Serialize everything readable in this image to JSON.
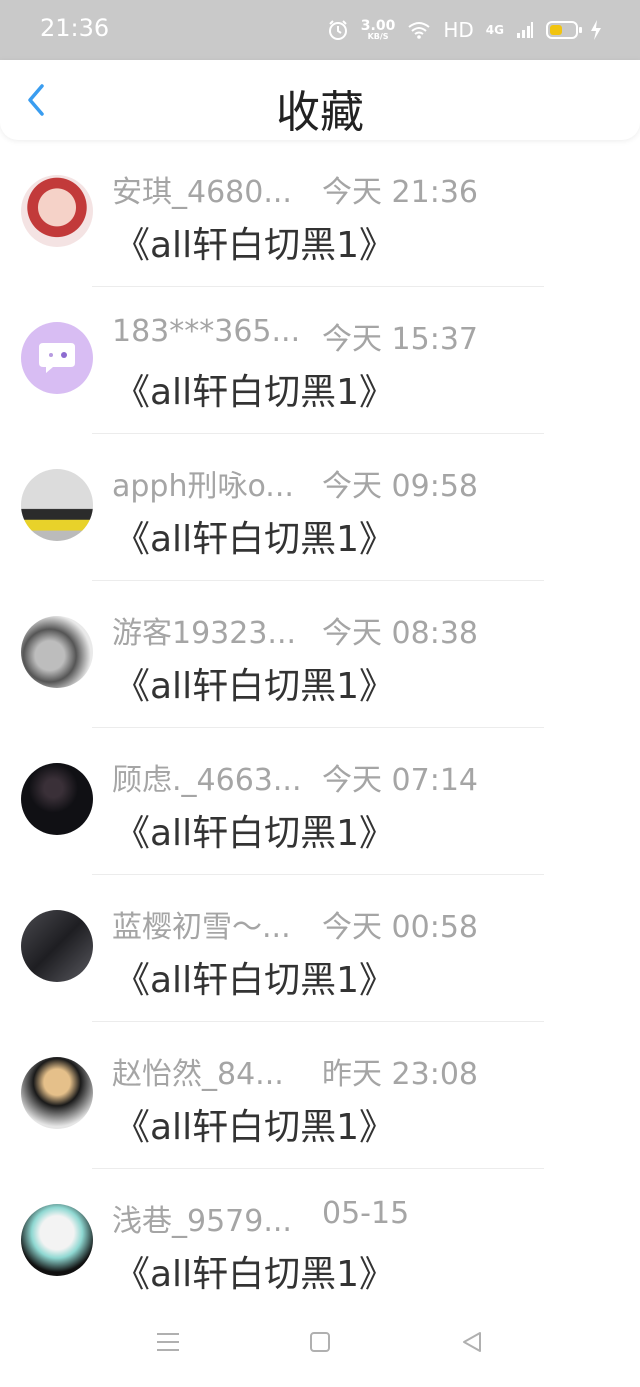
{
  "status_bar": {
    "time": "21:36",
    "speed_value": "3.00",
    "speed_unit": "KB/S",
    "hd": "HD",
    "network": "4G",
    "icons": [
      "alarm-icon",
      "wifi-icon",
      "signal-icon",
      "battery-icon",
      "charging-icon"
    ]
  },
  "header": {
    "title": "收藏",
    "back_icon": "chevron-left-icon"
  },
  "favorites": [
    {
      "name": "安琪_4680...",
      "time": "今天 21:36",
      "book": "《all轩白切黑1》"
    },
    {
      "name": "183***365...",
      "time": "今天 15:37",
      "book": "《all轩白切黑1》"
    },
    {
      "name": "apph刑咏o...",
      "time": "今天 09:58",
      "book": "《all轩白切黑1》"
    },
    {
      "name": "游客19323...",
      "time": "今天 08:38",
      "book": "《all轩白切黑1》"
    },
    {
      "name": "顾虑._4663...",
      "time": "今天 07:14",
      "book": "《all轩白切黑1》"
    },
    {
      "name": "蓝樱初雪～...",
      "time": "今天 00:58",
      "book": "《all轩白切黑1》"
    },
    {
      "name": "赵怡然_84...",
      "time": "昨天 23:08",
      "book": "《all轩白切黑1》"
    },
    {
      "name": "浅巷_9579...",
      "time": "05-15",
      "book": "《all轩白切黑1》"
    }
  ],
  "nav_bar": {
    "icons": [
      "menu-icon",
      "home-icon",
      "back-icon"
    ]
  },
  "colors": {
    "accent": "#3a9df0",
    "status_bar": "#c9c9c9",
    "meta_text": "#a5a5a5",
    "title_text": "#222222"
  }
}
